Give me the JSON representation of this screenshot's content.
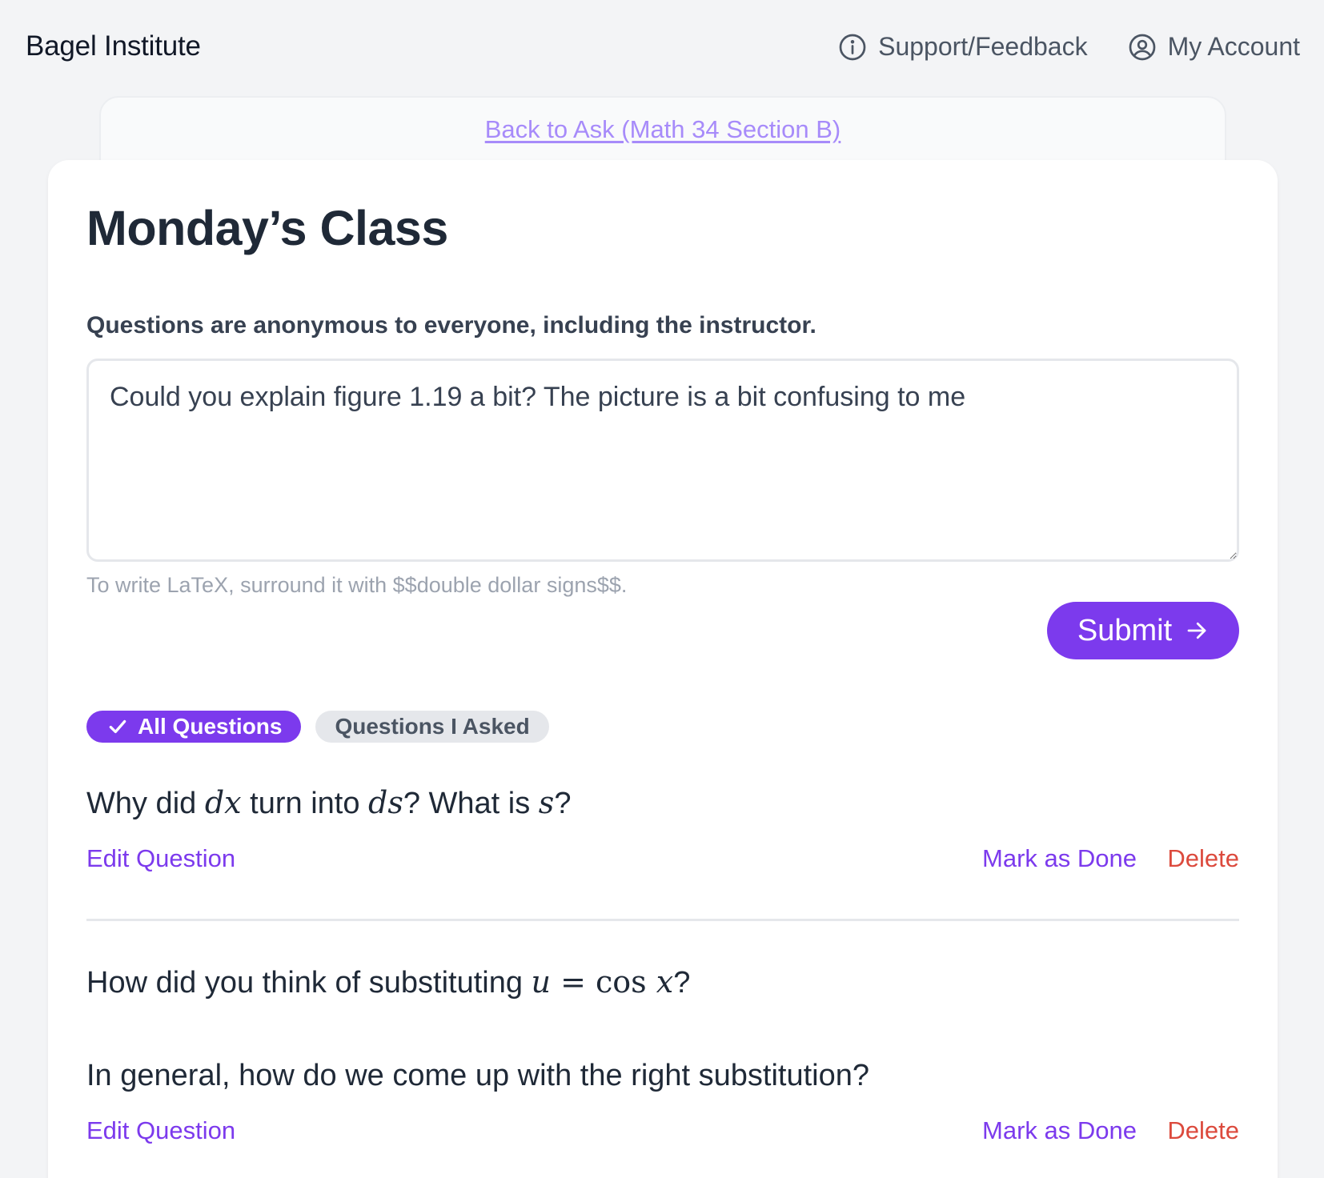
{
  "header": {
    "brand": "Bagel Institute",
    "support_label": "Support/Feedback",
    "account_label": "My Account"
  },
  "back_link": "Back to Ask (Math 34 Section B)",
  "page": {
    "title": "Monday’s Class",
    "anonymity_note": "Questions are anonymous to everyone, including the instructor.",
    "question_input_value": "Could you explain figure 1.19 a bit? The picture is a bit confusing to me",
    "latex_hint": "To write LaTeX, surround it with $$double dollar signs$$.",
    "submit_label": "Submit"
  },
  "filters": [
    {
      "label": "All Questions",
      "selected": true
    },
    {
      "label": "Questions I Asked",
      "selected": false
    }
  ],
  "questions": [
    {
      "parts": {
        "t1": "Why did ",
        "m1": "dx",
        "t2": " turn into ",
        "m2": "ds",
        "t3": "? What is ",
        "m3": "s",
        "t4": "?"
      }
    },
    {
      "line1": {
        "t1": "How did you think of substituting ",
        "m1": "u",
        "m2": " = ",
        "m3": "cos",
        "m4": " x",
        "t2": "?"
      },
      "line2": "In general, how do we come up with the right substitution?"
    }
  ],
  "actions": {
    "edit": "Edit Question",
    "done": "Mark as Done",
    "delete": "Delete"
  },
  "colors": {
    "accent": "#7c3aed",
    "danger": "#dc4a3d",
    "link_light": "#a78bfa",
    "background": "#f3f4f6"
  }
}
